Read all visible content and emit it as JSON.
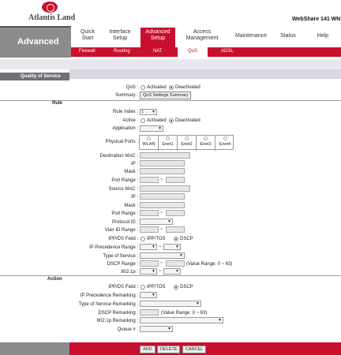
{
  "header": {
    "brand": "Atlantis Land",
    "model": "WebShare 141 WN",
    "section": "Advanced"
  },
  "nav": {
    "items": [
      {
        "label": "Quick\nStart"
      },
      {
        "label": "Interface\nSetup"
      },
      {
        "label": "Advanced\nSetup"
      },
      {
        "label": "Access\nManagement"
      },
      {
        "label": "Maintenance"
      },
      {
        "label": "Status"
      },
      {
        "label": "Help"
      }
    ],
    "sub": [
      "Firewall",
      "Routing",
      "NAT",
      "QoS",
      "ADSL"
    ]
  },
  "sidebar": {
    "qos_title": "Quality of Service",
    "rule": "Rule",
    "action": "Action"
  },
  "qos": {
    "label": "QoS :",
    "activated": "Activated",
    "deactivated": "Deactivated",
    "summary_label": "Summary :",
    "summary_btn": "QoS Settings Summary"
  },
  "rule": {
    "index_label": "Rule Index :",
    "index_value": "1",
    "active_label": "Active :",
    "activated": "Activated",
    "deactivated": "Deactivated",
    "app_label": "Application :",
    "ports_label": "Physical Ports :",
    "ports": [
      "WLAN",
      "Enet1",
      "Enet2",
      "Enet3",
      "Enet4"
    ],
    "dest_mac": "Destination MAC :",
    "ip": "IP :",
    "mask": "Mask :",
    "port_range": "Port Range :",
    "src_mac": "Source MAC :",
    "ip2": "IP :",
    "mask2": "Mask :",
    "port_range2": "Port Range :",
    "protocol": "Protocol ID :",
    "vlan": "Vlan ID Range :",
    "ipds": "IPP/DS Field :",
    "ipp_tos": "IPP/TOS",
    "dscp": "DSCP",
    "ip_prec": "IP Precedence Range :",
    "tos": "Type of Service :",
    "dscp_range": "DSCP Range :",
    "dscp_note": "(Value Range: 0 ~ 63)",
    "p8021": "802.1p :"
  },
  "action": {
    "ipds": "IPP/DS Field :",
    "ipp_tos": "IPP/TOS",
    "dscp": "DSCP",
    "ip_prec_remark": "IP Precedence Remarking :",
    "tos_remark": "Type of Service Remarking :",
    "dscp_remark": "DSCP Remarking :",
    "dscp_note": "(Value Range: 0 ~ 63)",
    "p8021_remark": "802.1p Remarking :",
    "queue": "Queue # :"
  },
  "buttons": {
    "add": "ADD",
    "delete": "DELETE",
    "cancel": "CANCEL"
  },
  "tilde": "~"
}
